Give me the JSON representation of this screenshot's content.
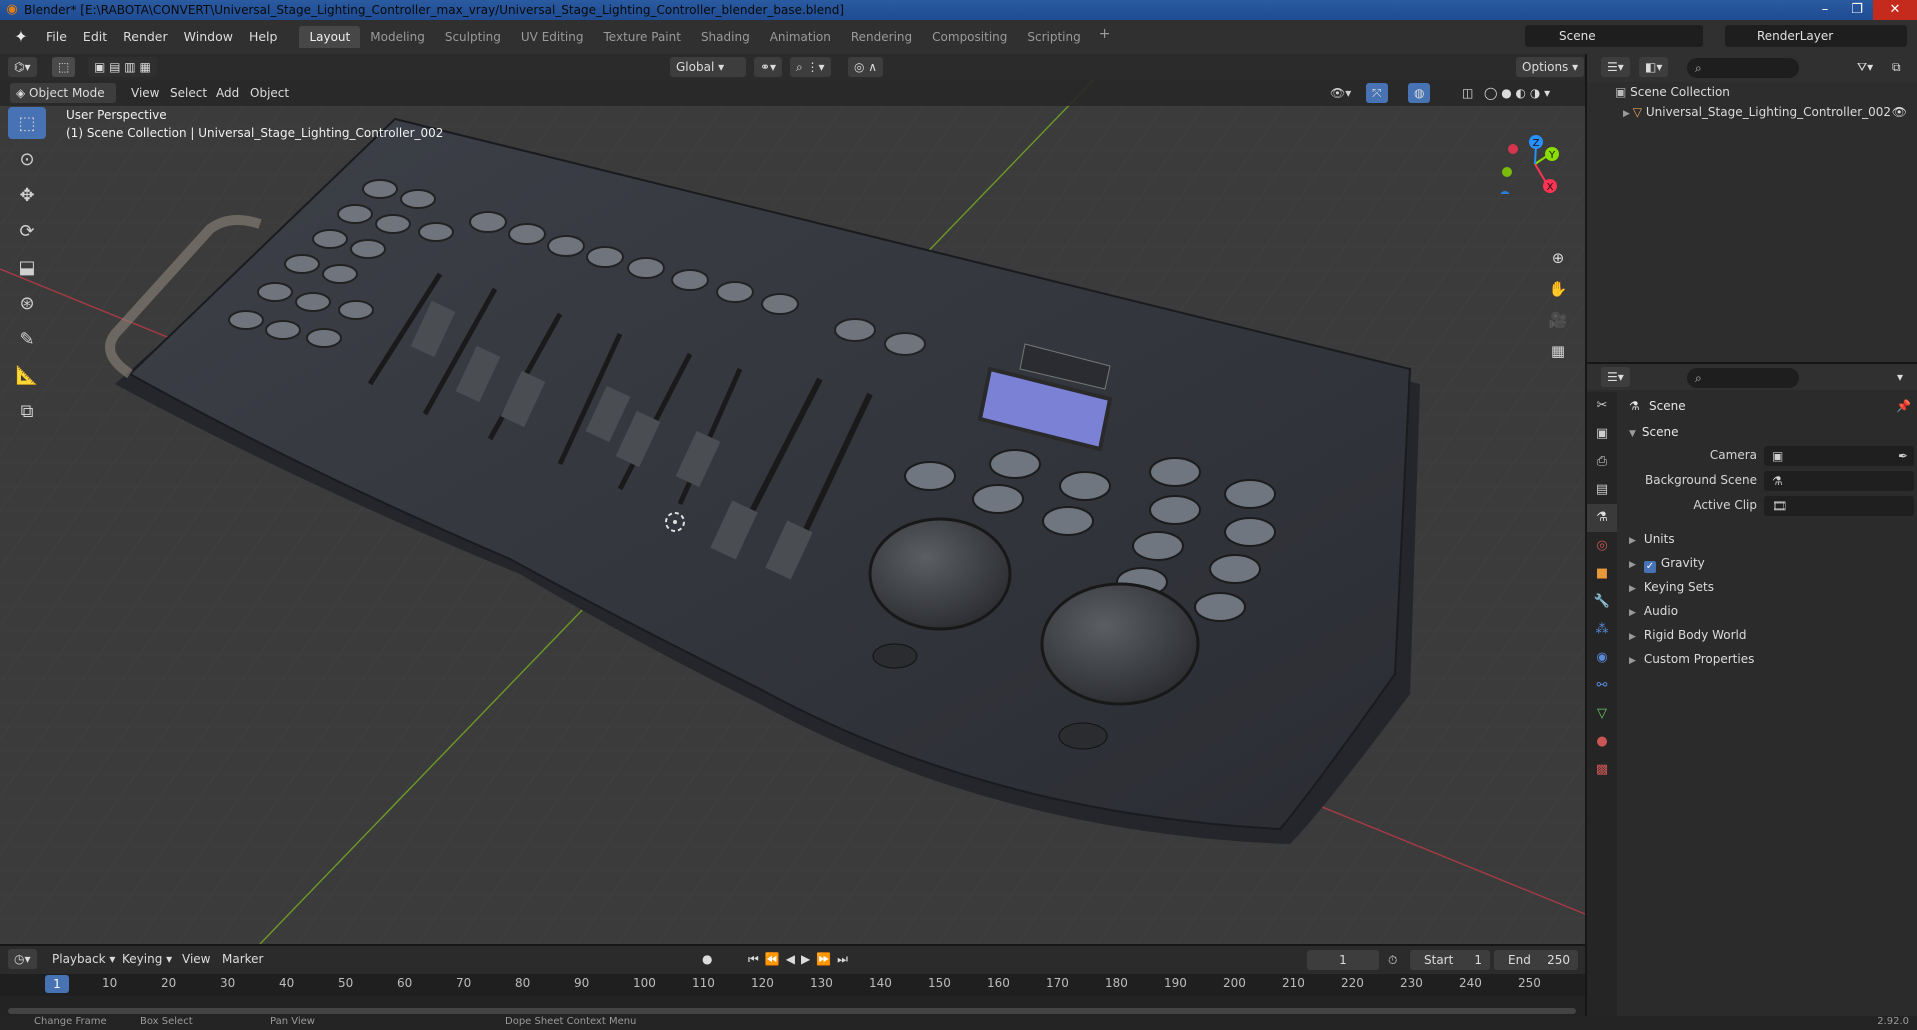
{
  "window": {
    "title": "Blender* [E:\\RABOTA\\CONVERT\\Universal_Stage_Lighting_Controller_max_vray/Universal_Stage_Lighting_Controller_blender_base.blend]",
    "controls": [
      "–",
      "❐",
      "✕"
    ]
  },
  "menu": {
    "items": [
      "File",
      "Edit",
      "Render",
      "Window",
      "Help"
    ],
    "workspaces": [
      "Layout",
      "Modeling",
      "Sculpting",
      "UV Editing",
      "Texture Paint",
      "Shading",
      "Animation",
      "Rendering",
      "Compositing",
      "Scripting"
    ],
    "active_workspace": "Layout",
    "scene": "Scene",
    "render_layer": "RenderLayer"
  },
  "viewport": {
    "transform": "Global",
    "options": "Options",
    "mode": "Object Mode",
    "header_menus": [
      "View",
      "Select",
      "Add",
      "Object"
    ],
    "perspective": "User Perspective",
    "collection_info": "(1) Scene Collection | Universal_Stage_Lighting_Controller_002",
    "gizmo_axes": [
      "X",
      "Y",
      "Z"
    ]
  },
  "toolbar": {
    "tools": [
      "select-box",
      "cursor",
      "move",
      "rotate",
      "scale",
      "transform",
      "annotate",
      "measure",
      "add-cube"
    ]
  },
  "outliner": {
    "root": "Scene Collection",
    "items": [
      "Universal_Stage_Lighting_Controller_002"
    ]
  },
  "properties": {
    "context": "Scene",
    "section": "Scene",
    "fields": [
      {
        "label": "Camera",
        "value": ""
      },
      {
        "label": "Background Scene",
        "value": ""
      },
      {
        "label": "Active Clip",
        "value": ""
      }
    ],
    "subsections": [
      "Units",
      "Gravity",
      "Keying Sets",
      "Audio",
      "Rigid Body World",
      "Custom Properties"
    ],
    "gravity_checked": true
  },
  "timeline": {
    "menus": [
      "Playback",
      "Keying",
      "View",
      "Marker"
    ],
    "current_frame": "1",
    "start_label": "Start",
    "start": "1",
    "end_label": "End",
    "end": "250",
    "ticks": [
      "1",
      "10",
      "20",
      "30",
      "40",
      "50",
      "60",
      "70",
      "80",
      "90",
      "100",
      "110",
      "120",
      "130",
      "140",
      "150",
      "160",
      "170",
      "180",
      "190",
      "200",
      "210",
      "220",
      "230",
      "240",
      "250"
    ]
  },
  "status": {
    "items": [
      "Change Frame",
      "Box Select",
      "Pan View",
      "Dope Sheet Context Menu"
    ],
    "version": "2.92.0"
  },
  "colors": {
    "accent": "#4772b3",
    "x_axis": "#ff3352",
    "y_axis": "#8bdc00",
    "z_axis": "#2890ff"
  }
}
